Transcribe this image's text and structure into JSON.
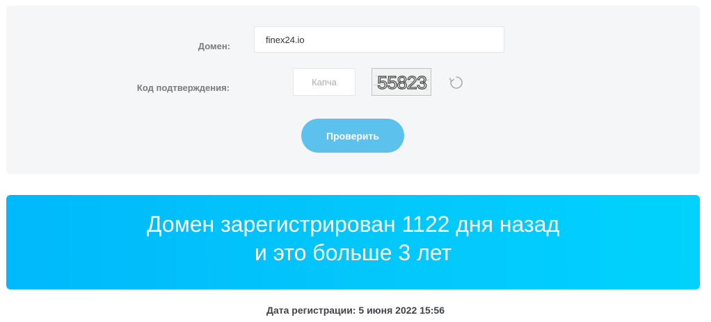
{
  "form": {
    "domain_label": "Домен:",
    "domain_value": "finex24.io",
    "code_label": "Код подтверждения:",
    "captcha_placeholder": "Капча",
    "captcha_text": "55823",
    "submit_label": "Проверить"
  },
  "result": {
    "line1": "Домен зарегистрирован 1122 дня назад",
    "line2": "и это больше 3 лет"
  },
  "registration": {
    "text": "Дата регистрации: 5 июня 2022 15:56"
  },
  "colors": {
    "panel_bg": "#f4f6f7",
    "button_bg": "#5cc1ed",
    "banner_bg": "#03c6fb"
  },
  "icons": {
    "refresh": "refresh-icon"
  }
}
